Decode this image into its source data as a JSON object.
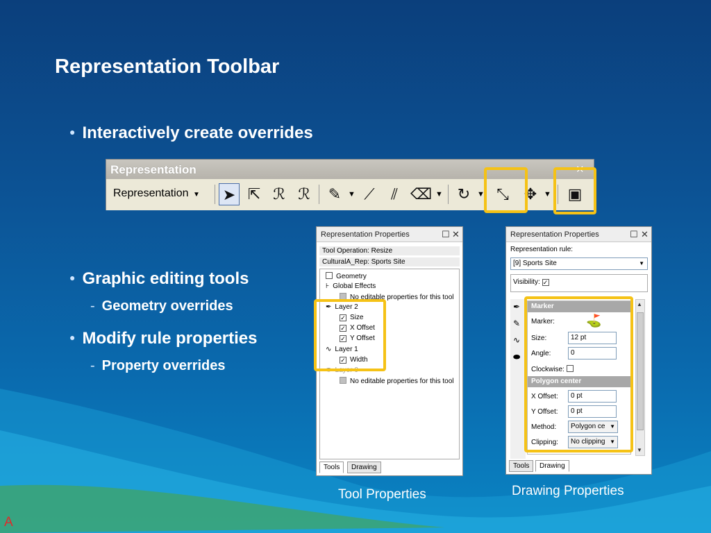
{
  "slide": {
    "title": "Representation Toolbar",
    "bullets": [
      "Interactively create overrides",
      "Graphic editing tools",
      "Modify  rule properties"
    ],
    "subbullets": [
      "Geometry overrides",
      "Property overrides"
    ],
    "captions": [
      "Tool Properties",
      "Drawing Properties"
    ],
    "corner_letter": "A"
  },
  "toolbar": {
    "title": "Representation",
    "dropdown_label": "Representation",
    "window_buttons": [
      "▫",
      "✕"
    ]
  },
  "tool_panel": {
    "title": "Representation Properties",
    "window_buttons": [
      "☐",
      "✕"
    ],
    "operation": "Tool Operation: Resize",
    "feature": "CulturalA_Rep: Sports Site",
    "tree": [
      "Geometry",
      "Global Effects",
      "No editable properties for this tool",
      "Layer 2",
      "Size",
      "X Offset",
      "Y Offset",
      "Layer 1",
      "Width",
      "Layer 0",
      "No editable properties for this tool"
    ],
    "tabs": [
      "Tools",
      "Drawing"
    ]
  },
  "drawing_panel": {
    "title": "Representation Properties",
    "window_buttons": [
      "☐",
      "✕"
    ],
    "rule_label": "Representation rule:",
    "rule_value": "[9] Sports Site",
    "visibility_label": "Visibility:",
    "marker_section": "Marker",
    "marker_label": "Marker:",
    "size_label": "Size:",
    "size_value": "12 pt",
    "angle_label": "Angle:",
    "angle_value": "0",
    "clockwise_label": "Clockwise:",
    "polygon_section": "Polygon center",
    "xoffset_label": "X Offset:",
    "xoffset_value": "0 pt",
    "yoffset_label": "Y Offset:",
    "yoffset_value": "0 pt",
    "method_label": "Method:",
    "method_value": "Polygon ce",
    "clipping_label": "Clipping:",
    "clipping_value": "No clipping",
    "tabs": [
      "Tools",
      "Drawing"
    ]
  },
  "colors": {
    "highlight": "#f5c216",
    "background": "#0c5294",
    "section_header": "#a8a8a8"
  }
}
